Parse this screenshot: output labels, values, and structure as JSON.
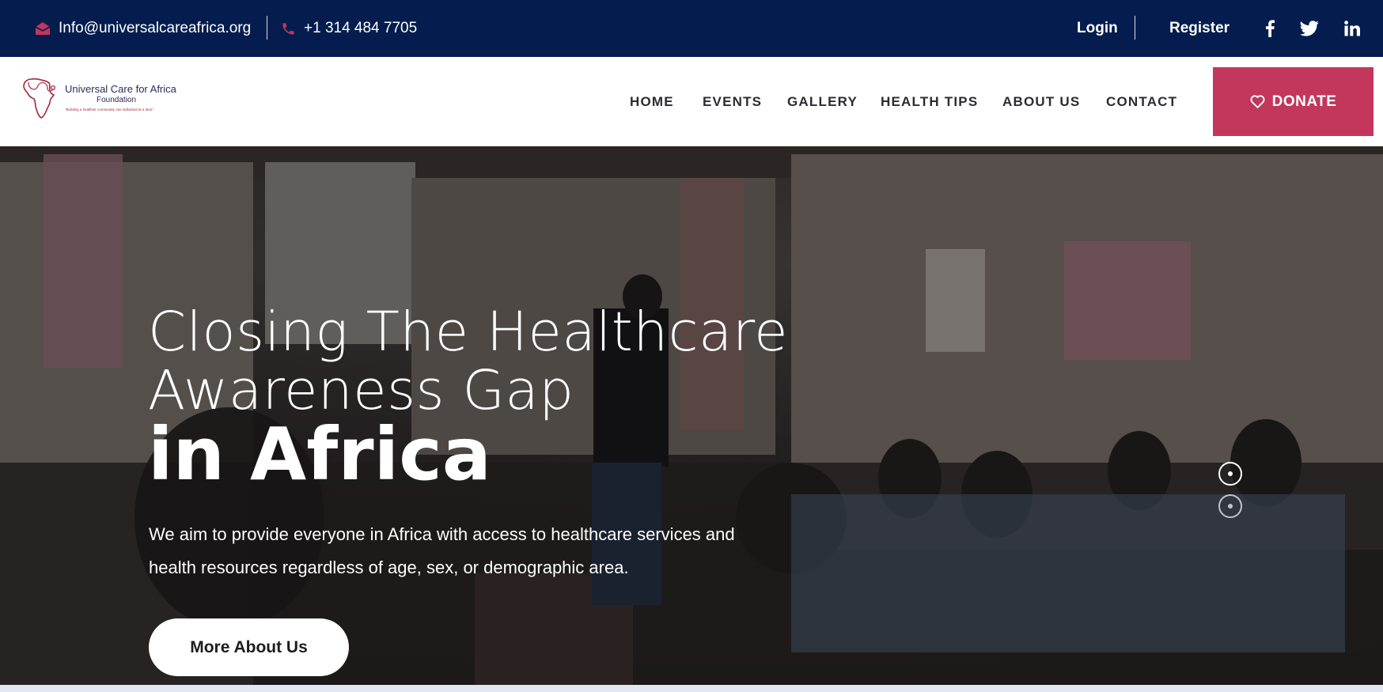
{
  "topbar": {
    "email": "Info@universalcareafrica.org",
    "phone": "+1 314 484 7705",
    "login_label": "Login",
    "register_label": "Register",
    "icons": {
      "email": "envelope-icon",
      "phone": "phone-icon",
      "facebook": "facebook-icon",
      "twitter": "twitter-icon",
      "linkedin": "linkedin-icon"
    },
    "accent_color": "#c2375b",
    "background_color": "#041d4e"
  },
  "header": {
    "logo": {
      "name": "Universal Care for Africa",
      "subtitle": "Foundation",
      "tagline": "\"Building a healthier community one individual at a time\""
    },
    "nav": [
      {
        "label": "HOME"
      },
      {
        "label": "EVENTS"
      },
      {
        "label": "GALLERY"
      },
      {
        "label": "HEALTH TIPS"
      },
      {
        "label": "ABOUT US"
      },
      {
        "label": "CONTACT"
      }
    ],
    "donate_label": "DONATE",
    "donate_color": "#c2375b"
  },
  "hero": {
    "title_line1": "Closing The Healthcare",
    "title_line2": "Awareness Gap",
    "title_bold": "in Africa",
    "description": "We aim to provide everyone in Africa with access to healthcare services and health resources regardless of age, sex, or demographic area.",
    "button_label": "More About Us",
    "slides_count": 2,
    "active_slide": 1
  }
}
